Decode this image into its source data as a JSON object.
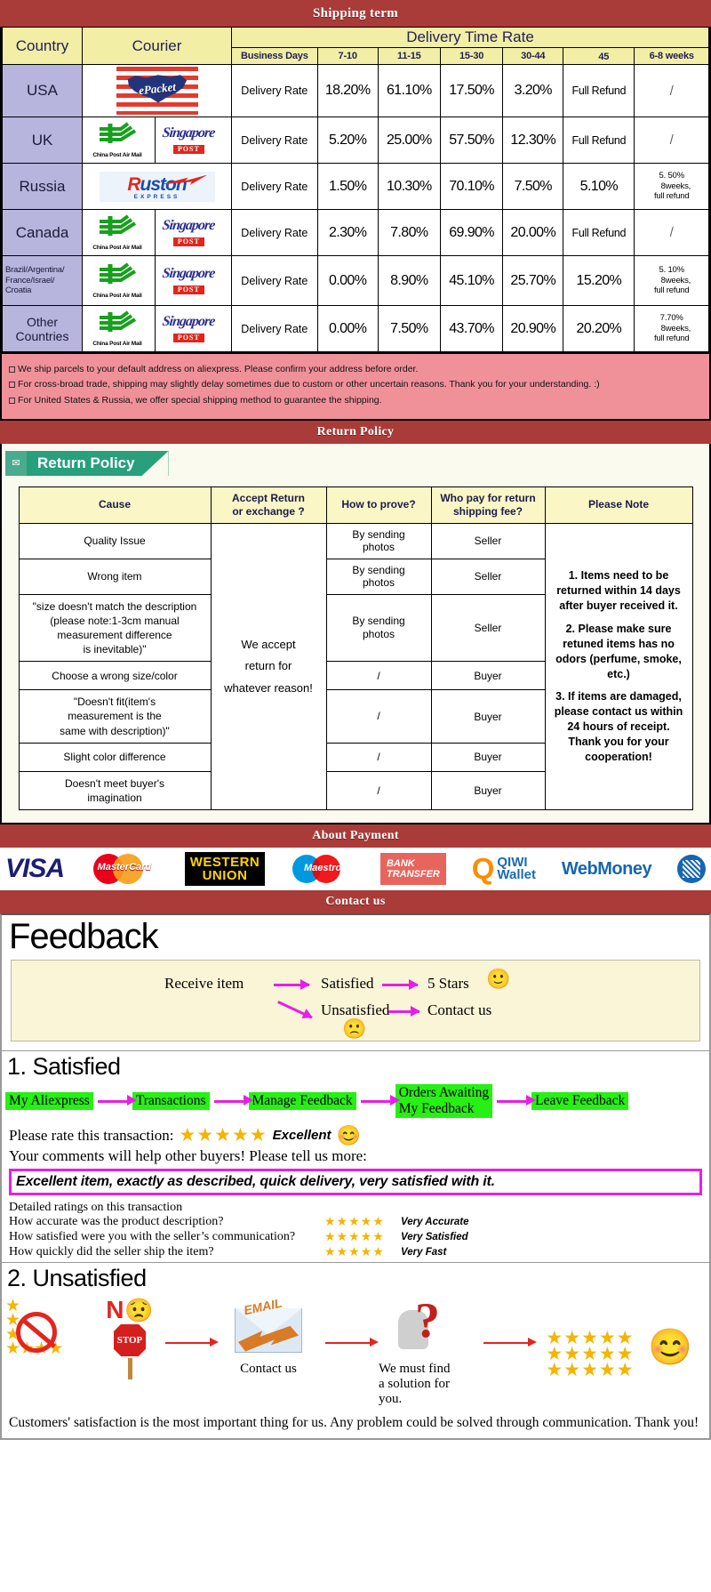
{
  "banners": {
    "shipping": "Shipping term",
    "return": "Return Policy",
    "payment": "About Payment",
    "contact": "Contact us"
  },
  "shipping_table": {
    "headers": {
      "country": "Country",
      "courier": "Courier",
      "delivery_time_rate": "Delivery Time Rate",
      "business_days": "Business Days",
      "ranges": [
        "7-10",
        "11-15",
        "15-30",
        "30-44",
        "　45",
        "6-8 weeks"
      ]
    },
    "rows": [
      {
        "country": "USA",
        "couriers": [
          "epacket"
        ],
        "label": "Delivery Rate",
        "values": [
          "18.20%",
          "61.10%",
          "17.50%",
          "3.20%",
          "Full Refund",
          "/"
        ]
      },
      {
        "country": "UK",
        "couriers": [
          "china-post-air-mail",
          "singapore-post"
        ],
        "label": "Delivery Rate",
        "values": [
          "5.20%",
          "25.00%",
          "57.50%",
          "12.30%",
          "Full Refund",
          "/"
        ]
      },
      {
        "country": "Russia",
        "couriers": [
          "ruston-express"
        ],
        "label": "Delivery Rate",
        "values": [
          "1.50%",
          "10.30%",
          "70.10%",
          "7.50%",
          "5.10%",
          "5. 50%\n　8weeks,\nfull refund"
        ]
      },
      {
        "country": "Canada",
        "couriers": [
          "china-post-air-mail",
          "singapore-post"
        ],
        "label": "Delivery Rate",
        "values": [
          "2.30%",
          "7.80%",
          "69.90%",
          "20.00%",
          "Full Refund",
          "/"
        ]
      },
      {
        "country": "Brazil/Argentina/\nFrance/Israel/\nCroatia",
        "couriers": [
          "china-post-air-mail",
          "singapore-post"
        ],
        "label": "Delivery Rate",
        "values": [
          "0.00%",
          "8.90%",
          "45.10%",
          "25.70%",
          "15.20%",
          "5. 10%\n　8weeks,\nfull refund"
        ]
      },
      {
        "country": "Other Countries",
        "couriers": [
          "china-post-air-mail",
          "singapore-post"
        ],
        "label": "Delivery Rate",
        "values": [
          "0.00%",
          "7.50%",
          "43.70%",
          "20.90%",
          "20.20%",
          "7.70%\n　8weeks,\nfull refund"
        ]
      }
    ],
    "notes": [
      "We ship parcels to your default address on aliexpress. Please confirm your address before order.",
      "For cross-broad trade, shipping may slightly delay sometimes due to custom or other uncertain reasons. Thank you for your understanding. :)",
      "For United States & Russia, we offer special shipping method to guarantee the shipping."
    ]
  },
  "return_policy": {
    "tag_label": "Return Policy",
    "headers": [
      "Cause",
      "Accept Return\nor exchange ?",
      "How to prove?",
      "Who pay for return\nshipping fee?",
      "Please Note"
    ],
    "accept_text": "We accept\nreturn for\nwhatever reason!",
    "rows": [
      {
        "cause": "Quality Issue",
        "prove": "By sending\nphotos",
        "who": "Seller"
      },
      {
        "cause": "Wrong item",
        "prove": "By sending\nphotos",
        "who": "Seller"
      },
      {
        "cause": "\"size doesn't match the description\n(please note:1-3cm manual\nmeasurement difference\nis inevitable)\"",
        "prove": "By sending\nphotos",
        "who": "Seller"
      },
      {
        "cause": "Choose a wrong size/color",
        "prove": "/",
        "who": "Buyer"
      },
      {
        "cause": "\"Doesn't fit(item's\nmeasurement is the\nsame with description)\"",
        "prove": "/",
        "who": "Buyer"
      },
      {
        "cause": "Slight color difference",
        "prove": "/",
        "who": "Buyer"
      },
      {
        "cause": "Doesn't meet buyer's\nimagination",
        "prove": "/",
        "who": "Buyer"
      }
    ],
    "notes": [
      "1. Items need to be returned within 14 days after buyer received it.",
      "2. Please make sure retuned items has no odors (perfume, smoke, etc.)",
      "3. If items are damaged, please contact us within 24 hours of receipt.\nThank you for your cooperation!"
    ]
  },
  "payment": {
    "methods": [
      {
        "name": "visa",
        "label": "VISA"
      },
      {
        "name": "mastercard",
        "label": "MasterCard"
      },
      {
        "name": "western-union",
        "label1": "WESTERN",
        "label2": "UNION"
      },
      {
        "name": "maestro",
        "label": "Maestro"
      },
      {
        "name": "bank-transfer",
        "label1": "BANK",
        "label2": "TRANSFER"
      },
      {
        "name": "qiwi-wallet",
        "label1": "QIWI",
        "label2": "Wallet"
      },
      {
        "name": "webmoney",
        "label": "WebMoney"
      }
    ]
  },
  "feedback": {
    "title": "Feedback",
    "flow": {
      "receive": "Receive item",
      "satisfied": "Satisfied",
      "five_stars": "5 Stars",
      "unsatisfied": "Unsatisfied",
      "contact_us": "Contact us",
      "happy_face": "🙂",
      "sad_face": "🙁"
    },
    "satisfied": {
      "heading": "1. Satisfied",
      "steps": [
        "My Aliexpress",
        "Transactions",
        "Manage Feedback",
        "Orders Awaiting\nMy Feedback",
        "Leave Feedback"
      ],
      "rate_prompt": "Please rate this transaction:",
      "stars": "★★★★★",
      "rating_word": "Excellent",
      "comment_prompt": "Your comments will help other buyers! Please tell us more:",
      "comment_text": "Excellent item, exactly as described, quick delivery, very satisfied with it.",
      "detailed_heading": "Detailed ratings on this transaction",
      "detailed": [
        {
          "question": "How accurate was the product description?",
          "stars": "★★★★★",
          "value": "Very Accurate"
        },
        {
          "question": "How satisfied were you with the seller’s communication?",
          "stars": "★★★★★",
          "value": "Very Satisfied"
        },
        {
          "question": "How quickly did the seller ship the item?",
          "stars": "★★★★★",
          "value": "Very Fast"
        }
      ]
    },
    "unsatisfied": {
      "heading": "2. Unsatisfied",
      "no_label": "N",
      "stop_label": "STOP",
      "email_label": "EMAIL",
      "contact_caption": "Contact us",
      "solution_caption": "We must find\na solution for\nyou.",
      "closing": "Customers' satisfaction is the most important thing for us. Any problem could be solved through communication. Thank you!"
    }
  },
  "colors": {
    "banner_red": "#a93b38",
    "header_yellow": "#f2eea6",
    "country_purple": "#b7b4dd",
    "pink_note": "#f0919a",
    "green_chip": "#27f014",
    "magenta": "#e81ee8",
    "teal_tag": "#28a07c",
    "star_gold": "#f5b400"
  }
}
